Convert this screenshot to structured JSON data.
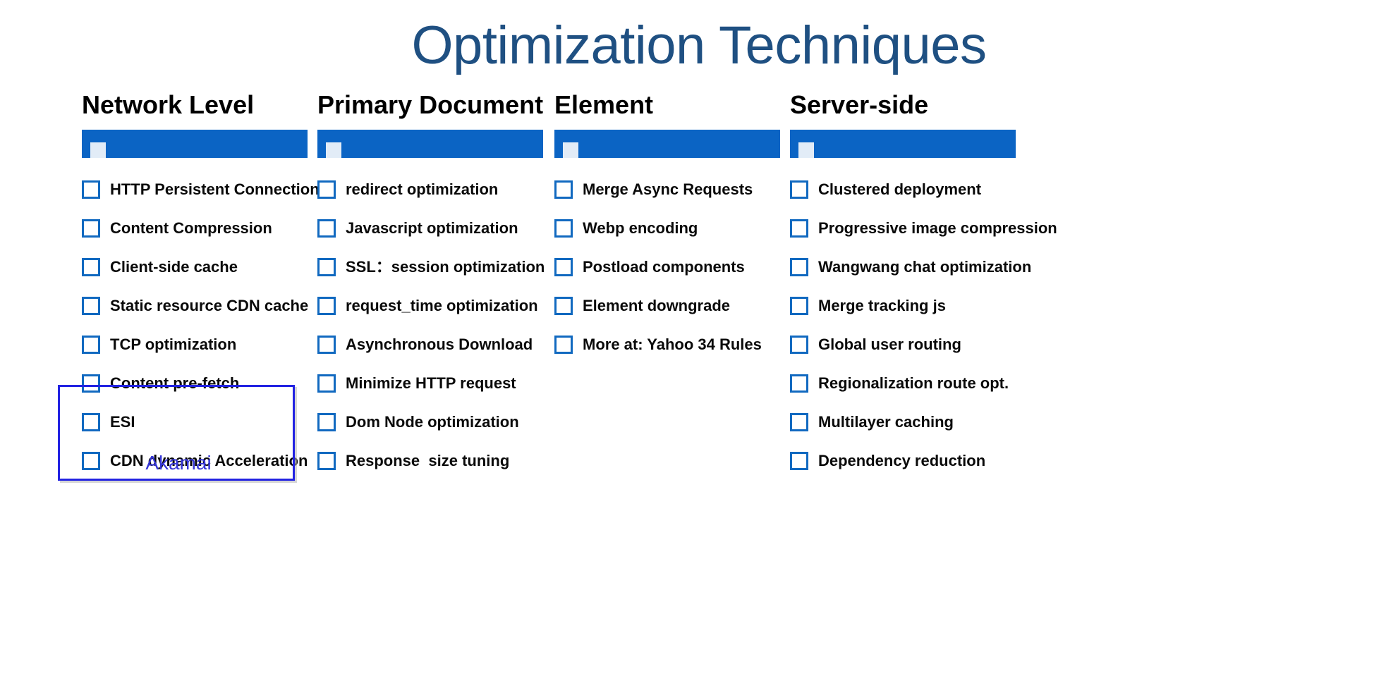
{
  "title": "Optimization Techniques",
  "colors": {
    "title": "#1F5082",
    "bar": "#0B64C4",
    "bar_chip": "#E2ECF7",
    "checkbox_border": "#1169C0",
    "highlight_border": "#2222E2",
    "highlight_label": "#3636D8",
    "label_text": "#0A0A0A",
    "background": "#FFFFFF"
  },
  "columns": [
    {
      "header": "Network Level",
      "items": [
        "HTTP Persistent Connection",
        "Content Compression",
        "Client-side cache",
        "Static resource CDN cache",
        "TCP optimization",
        "Content pre-fetch",
        "ESI",
        "CDN dynamic Acceleration"
      ]
    },
    {
      "header": "Primary Document",
      "items": [
        "redirect optimization",
        "Javascript optimization",
        "SSL：session optimization",
        "request_time optimization",
        "Asynchronous Download",
        "Minimize HTTP request",
        "Dom Node optimization",
        "Response  size tuning"
      ]
    },
    {
      "header": "Element",
      "items": [
        "Merge Async Requests",
        "Webp encoding",
        "Postload components",
        "Element downgrade",
        "More at: Yahoo 34 Rules"
      ]
    },
    {
      "header": "Server-side",
      "items": [
        "Clustered deployment",
        "Progressive image compression",
        "Wangwang chat optimization",
        "Merge tracking js",
        "Global user routing",
        "Regionalization route opt.",
        "Multilayer caching",
        "Dependency reduction"
      ]
    }
  ],
  "highlight": {
    "label": "Akamai"
  }
}
